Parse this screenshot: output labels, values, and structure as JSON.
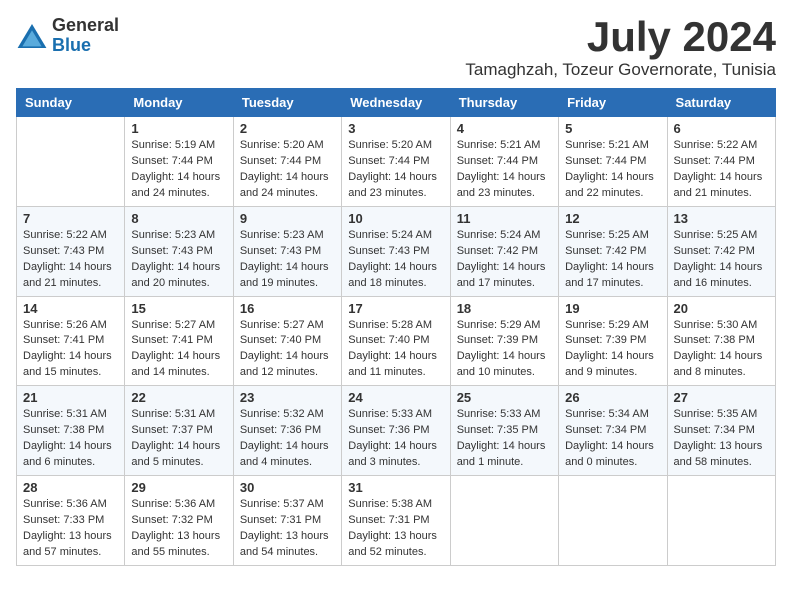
{
  "logo": {
    "general": "General",
    "blue": "Blue"
  },
  "title": "July 2024",
  "location": "Tamaghzah, Tozeur Governorate, Tunisia",
  "days_header": [
    "Sunday",
    "Monday",
    "Tuesday",
    "Wednesday",
    "Thursday",
    "Friday",
    "Saturday"
  ],
  "weeks": [
    [
      {
        "num": "",
        "info": ""
      },
      {
        "num": "1",
        "info": "Sunrise: 5:19 AM\nSunset: 7:44 PM\nDaylight: 14 hours\nand 24 minutes."
      },
      {
        "num": "2",
        "info": "Sunrise: 5:20 AM\nSunset: 7:44 PM\nDaylight: 14 hours\nand 24 minutes."
      },
      {
        "num": "3",
        "info": "Sunrise: 5:20 AM\nSunset: 7:44 PM\nDaylight: 14 hours\nand 23 minutes."
      },
      {
        "num": "4",
        "info": "Sunrise: 5:21 AM\nSunset: 7:44 PM\nDaylight: 14 hours\nand 23 minutes."
      },
      {
        "num": "5",
        "info": "Sunrise: 5:21 AM\nSunset: 7:44 PM\nDaylight: 14 hours\nand 22 minutes."
      },
      {
        "num": "6",
        "info": "Sunrise: 5:22 AM\nSunset: 7:44 PM\nDaylight: 14 hours\nand 21 minutes."
      }
    ],
    [
      {
        "num": "7",
        "info": "Sunrise: 5:22 AM\nSunset: 7:43 PM\nDaylight: 14 hours\nand 21 minutes."
      },
      {
        "num": "8",
        "info": "Sunrise: 5:23 AM\nSunset: 7:43 PM\nDaylight: 14 hours\nand 20 minutes."
      },
      {
        "num": "9",
        "info": "Sunrise: 5:23 AM\nSunset: 7:43 PM\nDaylight: 14 hours\nand 19 minutes."
      },
      {
        "num": "10",
        "info": "Sunrise: 5:24 AM\nSunset: 7:43 PM\nDaylight: 14 hours\nand 18 minutes."
      },
      {
        "num": "11",
        "info": "Sunrise: 5:24 AM\nSunset: 7:42 PM\nDaylight: 14 hours\nand 17 minutes."
      },
      {
        "num": "12",
        "info": "Sunrise: 5:25 AM\nSunset: 7:42 PM\nDaylight: 14 hours\nand 17 minutes."
      },
      {
        "num": "13",
        "info": "Sunrise: 5:25 AM\nSunset: 7:42 PM\nDaylight: 14 hours\nand 16 minutes."
      }
    ],
    [
      {
        "num": "14",
        "info": "Sunrise: 5:26 AM\nSunset: 7:41 PM\nDaylight: 14 hours\nand 15 minutes."
      },
      {
        "num": "15",
        "info": "Sunrise: 5:27 AM\nSunset: 7:41 PM\nDaylight: 14 hours\nand 14 minutes."
      },
      {
        "num": "16",
        "info": "Sunrise: 5:27 AM\nSunset: 7:40 PM\nDaylight: 14 hours\nand 12 minutes."
      },
      {
        "num": "17",
        "info": "Sunrise: 5:28 AM\nSunset: 7:40 PM\nDaylight: 14 hours\nand 11 minutes."
      },
      {
        "num": "18",
        "info": "Sunrise: 5:29 AM\nSunset: 7:39 PM\nDaylight: 14 hours\nand 10 minutes."
      },
      {
        "num": "19",
        "info": "Sunrise: 5:29 AM\nSunset: 7:39 PM\nDaylight: 14 hours\nand 9 minutes."
      },
      {
        "num": "20",
        "info": "Sunrise: 5:30 AM\nSunset: 7:38 PM\nDaylight: 14 hours\nand 8 minutes."
      }
    ],
    [
      {
        "num": "21",
        "info": "Sunrise: 5:31 AM\nSunset: 7:38 PM\nDaylight: 14 hours\nand 6 minutes."
      },
      {
        "num": "22",
        "info": "Sunrise: 5:31 AM\nSunset: 7:37 PM\nDaylight: 14 hours\nand 5 minutes."
      },
      {
        "num": "23",
        "info": "Sunrise: 5:32 AM\nSunset: 7:36 PM\nDaylight: 14 hours\nand 4 minutes."
      },
      {
        "num": "24",
        "info": "Sunrise: 5:33 AM\nSunset: 7:36 PM\nDaylight: 14 hours\nand 3 minutes."
      },
      {
        "num": "25",
        "info": "Sunrise: 5:33 AM\nSunset: 7:35 PM\nDaylight: 14 hours\nand 1 minute."
      },
      {
        "num": "26",
        "info": "Sunrise: 5:34 AM\nSunset: 7:34 PM\nDaylight: 14 hours\nand 0 minutes."
      },
      {
        "num": "27",
        "info": "Sunrise: 5:35 AM\nSunset: 7:34 PM\nDaylight: 13 hours\nand 58 minutes."
      }
    ],
    [
      {
        "num": "28",
        "info": "Sunrise: 5:36 AM\nSunset: 7:33 PM\nDaylight: 13 hours\nand 57 minutes."
      },
      {
        "num": "29",
        "info": "Sunrise: 5:36 AM\nSunset: 7:32 PM\nDaylight: 13 hours\nand 55 minutes."
      },
      {
        "num": "30",
        "info": "Sunrise: 5:37 AM\nSunset: 7:31 PM\nDaylight: 13 hours\nand 54 minutes."
      },
      {
        "num": "31",
        "info": "Sunrise: 5:38 AM\nSunset: 7:31 PM\nDaylight: 13 hours\nand 52 minutes."
      },
      {
        "num": "",
        "info": ""
      },
      {
        "num": "",
        "info": ""
      },
      {
        "num": "",
        "info": ""
      }
    ]
  ]
}
